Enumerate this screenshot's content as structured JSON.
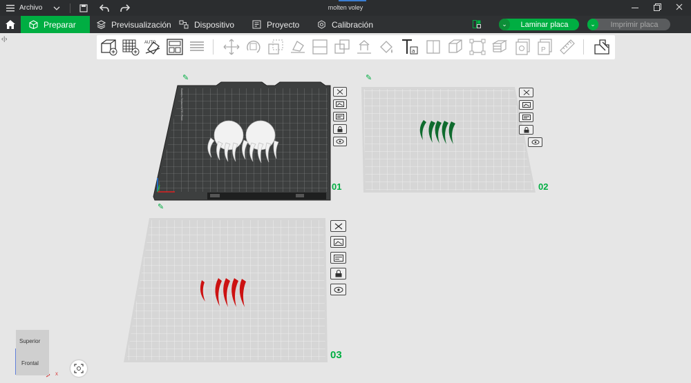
{
  "titlebar": {
    "menu_label": "Archivo",
    "window_title": "molten voley",
    "accent": "#3a7ed3"
  },
  "tabs": [
    {
      "label": "Preparar",
      "icon": "cube-icon",
      "active": true
    },
    {
      "label": "Previsualización",
      "icon": "layers-icon",
      "active": false
    },
    {
      "label": "Dispositivo",
      "icon": "device-icon",
      "active": false
    },
    {
      "label": "Proyecto",
      "icon": "project-icon",
      "active": false
    },
    {
      "label": "Calibración",
      "icon": "calibration-icon",
      "active": false
    }
  ],
  "actions": {
    "slice_label": "Laminar placa",
    "print_label": "Imprimir placa"
  },
  "colors": {
    "brand_green": "#00ae42",
    "plate_dark": "#3d3f3f",
    "plate_light": "#d6d6d6",
    "model_white": "#f2f2f2",
    "model_green": "#0f6b2e",
    "model_red": "#cc1212"
  },
  "toolbar_icons": [
    "add-object-icon",
    "add-plate-icon",
    "auto-orient-icon",
    "arrange-icon",
    "split-layers-icon",
    "move-icon",
    "rotate-icon",
    "scale-icon",
    "lay-on-face-icon",
    "cut-icon",
    "support-paint-icon",
    "seam-paint-icon",
    "color-paint-icon",
    "text-icon",
    "mesh-boolean-icon",
    "cube-icon",
    "fit-icon",
    "variable-height-icon",
    "assembly-icon",
    "measure-icon",
    "objects-icon"
  ],
  "plates": [
    {
      "number": "01",
      "style": "dark",
      "selected": true
    },
    {
      "number": "02",
      "style": "light",
      "model_color": "green"
    },
    {
      "number": "03",
      "style": "light",
      "model_color": "red"
    }
  ],
  "plate_side_icons": [
    "close-icon",
    "arrange-plate-icon",
    "plate-settings-icon",
    "lock-icon",
    "eye-icon"
  ],
  "viewcube": {
    "top_label": "Superior",
    "front_label": "Frontal",
    "axis_x": "x"
  }
}
